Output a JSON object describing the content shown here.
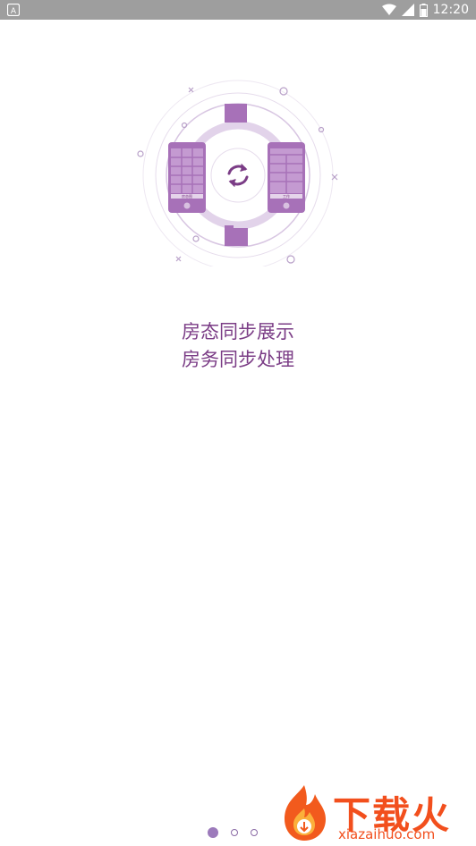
{
  "status_bar": {
    "left_icon": "a-notification-icon",
    "icons": [
      "wifi-icon",
      "signal-icon",
      "battery-icon"
    ],
    "time": "12:20"
  },
  "illustration": {
    "left_phone_label": "房态图",
    "right_phone_label": "工作",
    "center_icon": "sync-icon"
  },
  "headline": {
    "line1": "房态同步展示",
    "line2": "房务同步处理"
  },
  "pager": {
    "total": 3,
    "active_index": 0
  },
  "watermark": {
    "title": "下载火",
    "url": "xiazaihuo.com"
  },
  "colors": {
    "primary": "#9c69b3",
    "headline": "#7b3d86",
    "watermark": "#f24f1d",
    "status_bar": "#9e9e9e"
  }
}
